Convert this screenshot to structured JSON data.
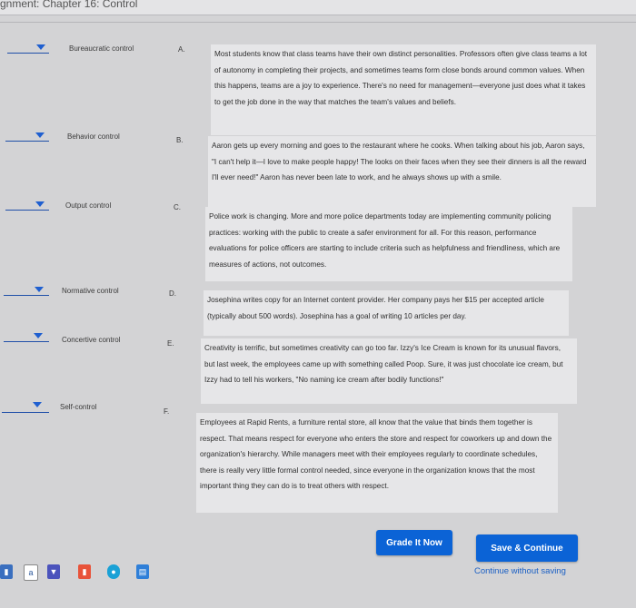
{
  "header": {
    "title": "gnment: Chapter 16: Control"
  },
  "matching": {
    "rows": [
      {
        "term": "Bureaucratic control",
        "letter": "A.",
        "description": "Most students know that class teams have their own distinct personalities. Professors often give class teams a lot of autonomy in completing their projects, and sometimes teams form close bonds around common values. When this happens, teams are a joy to experience. There's no need for management—everyone just does what it takes to get the job done in the way that matches the team's values and beliefs."
      },
      {
        "term": "Behavior control",
        "letter": "B.",
        "description": "Aaron gets up every morning and goes to the restaurant where he cooks. When talking about his job, Aaron says, \"I can't help it—I love to make people happy! The looks on their faces when they see their dinners is all the reward I'll ever need!\" Aaron has never been late to work, and he always shows up with a smile."
      },
      {
        "term": "Output control",
        "letter": "C.",
        "description": "Police work is changing. More and more police departments today are implementing community policing practices: working with the public to create a safer environment for all. For this reason, performance evaluations for police officers are starting to include criteria such as helpfulness and friendliness, which are measures of actions, not outcomes."
      },
      {
        "term": "Normative control",
        "letter": "D.",
        "description": "Josephina writes copy for an Internet content provider. Her company pays her $15 per accepted article (typically about 500 words). Josephina has a goal of writing 10 articles per day."
      },
      {
        "term": "Concertive control",
        "letter": "E.",
        "description": "Creativity is terrific, but sometimes creativity can go too far. Izzy's Ice Cream is known for its unusual flavors, but last week, the employees came up with something called Poop. Sure, it was just chocolate ice cream, but Izzy had to tell his workers, \"No naming ice cream after bodily functions!\""
      },
      {
        "term": "Self-control",
        "letter": "F.",
        "description": "Employees at Rapid Rents, a furniture rental store, all know that the value that binds them together is respect. That means respect for everyone who enters the store and respect for coworkers up and down the organization's hierarchy. While managers meet with their employees regularly to coordinate schedules, there is really very little formal control needed, since everyone in the organization knows that the most important thing they can do is to treat others with respect."
      }
    ]
  },
  "actions": {
    "grade_label": "Grade It Now",
    "save_label": "Save & Continue",
    "continue_label": "Continue without saving"
  },
  "taskbar": {
    "icons": [
      "file-icon",
      "word-icon",
      "teams-icon",
      "office-icon",
      "edge-icon",
      "image-viewer-icon"
    ]
  }
}
